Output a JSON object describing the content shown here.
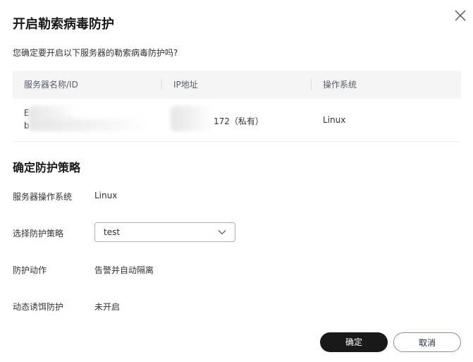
{
  "dialog": {
    "title": "开启勒索病毒防护",
    "subtitle": "您确定要开启以下服务器的勒索病毒防护吗?"
  },
  "table": {
    "headers": [
      "服务器名称/ID",
      "IP地址",
      "操作系统"
    ],
    "rows": [
      {
        "name_prefix_1": "E",
        "name_prefix_2": "b",
        "ip_suffix": "172（私有）",
        "os": "Linux"
      }
    ]
  },
  "policy": {
    "section_title": "确定防护策略",
    "os_label": "服务器操作系统",
    "os_value": "Linux",
    "strategy_label": "选择防护策略",
    "strategy_value": "test",
    "action_label": "防护动作",
    "action_value": "告警并自动隔离",
    "honeypot_label": "动态诱饵防护",
    "honeypot_value": "未开启"
  },
  "footer": {
    "confirm_label": "确定",
    "cancel_label": "取消"
  },
  "colors": {
    "primary_button": "#191919",
    "header_bg": "#f5f5f5"
  },
  "icons": {
    "close": "close-icon",
    "dropdown": "chevron-down-icon"
  }
}
